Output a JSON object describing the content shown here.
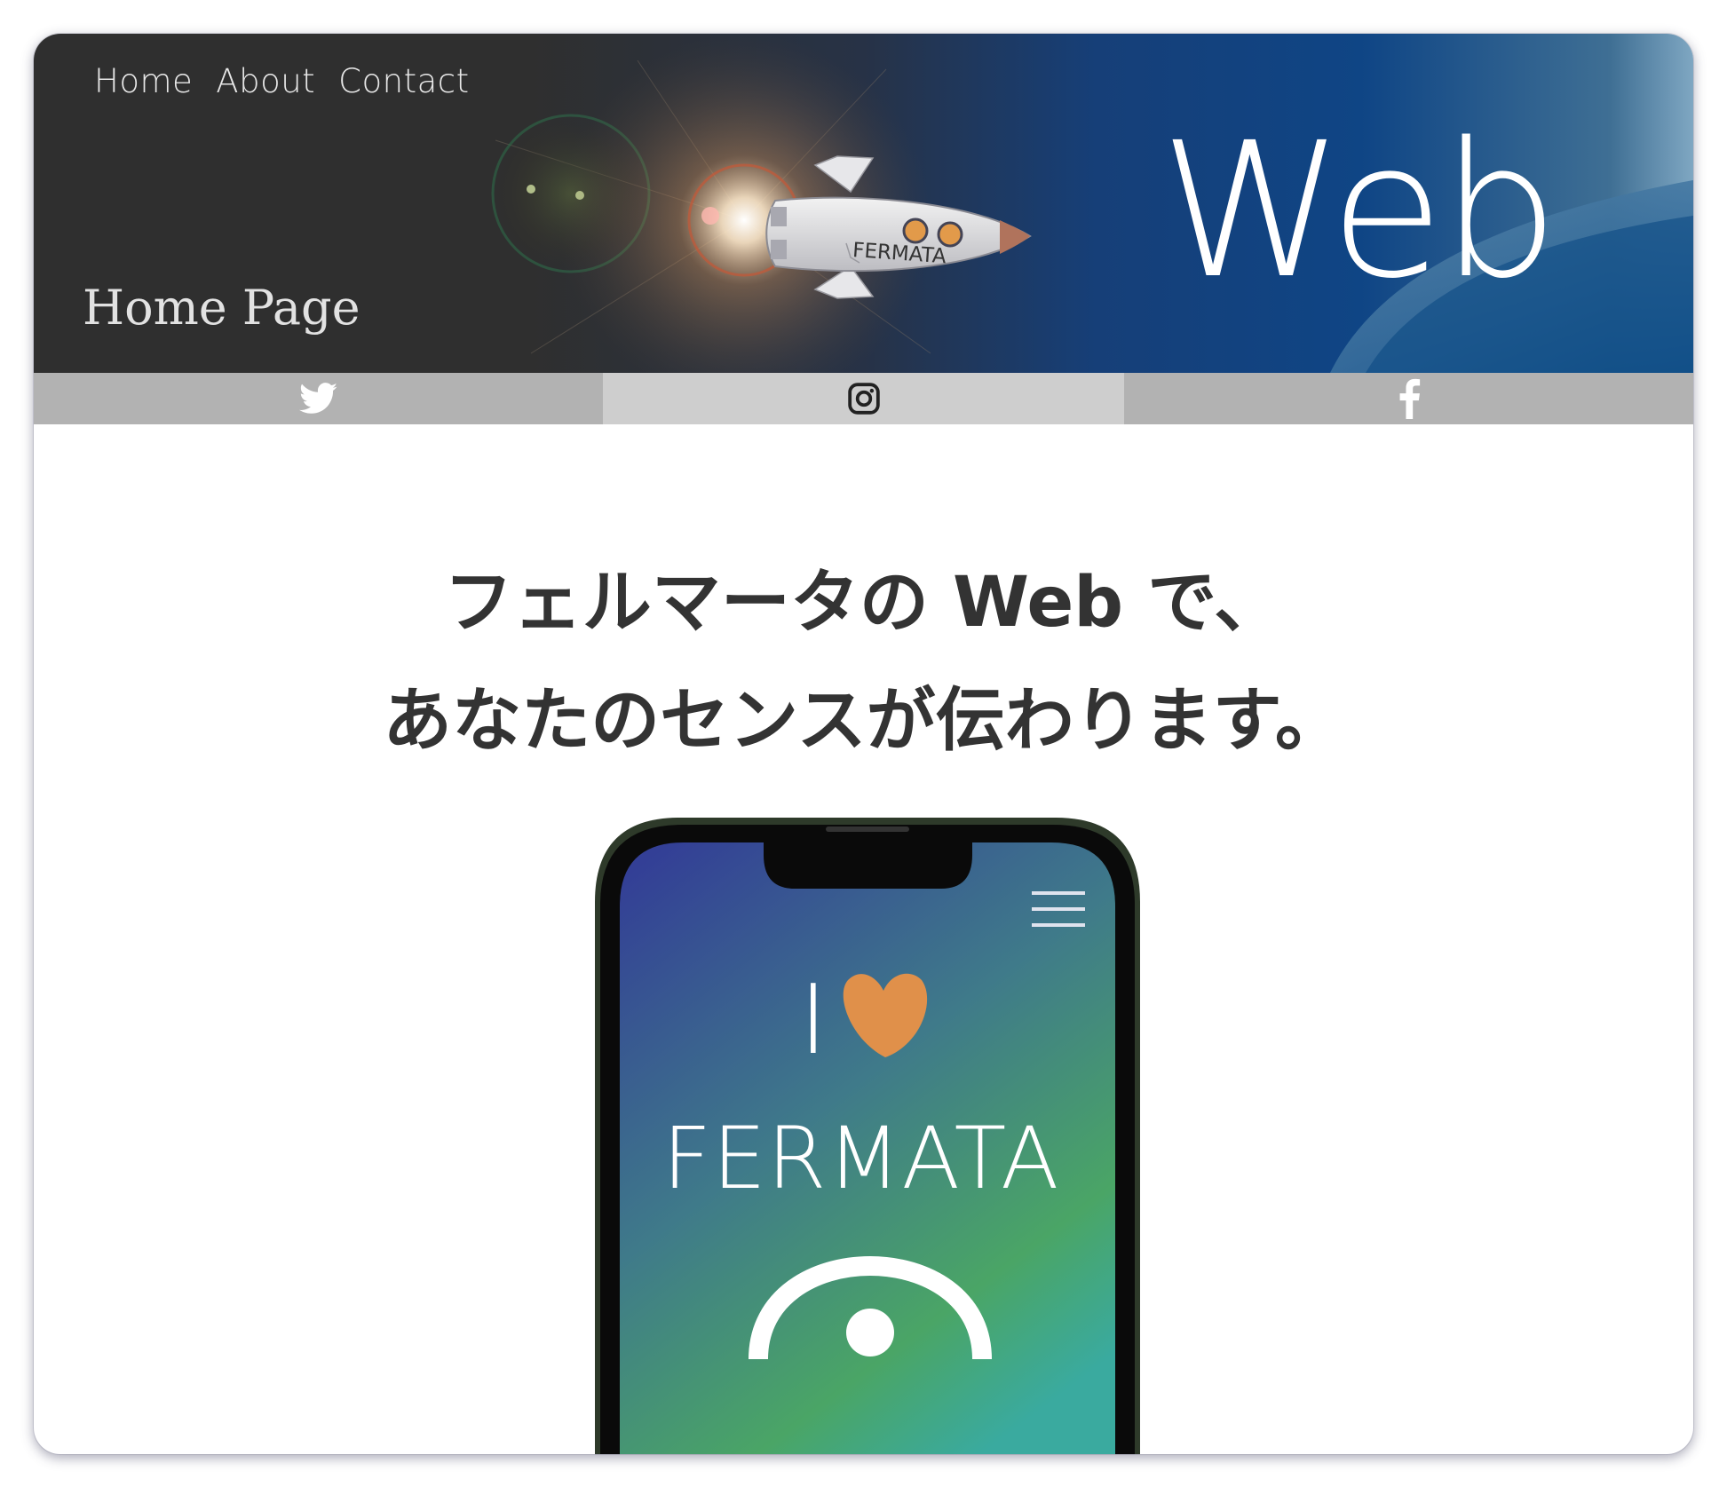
{
  "nav": {
    "items": [
      "Home",
      "About",
      "Contact"
    ]
  },
  "hero": {
    "title": "Home Page",
    "brand": "Web",
    "rocket_label": "FERMATA"
  },
  "social": {
    "icons": [
      "twitter-icon",
      "instagram-icon",
      "facebook-icon"
    ],
    "colors": {
      "side": "#b2b2b2",
      "middle": "#cecece"
    }
  },
  "main": {
    "headline_line1": "フェルマータの Web で、",
    "headline_line2": "あなたのセンスが伝わります。"
  },
  "phone": {
    "line1": "I",
    "line2": "FERMATA",
    "heart_color": "#e0904a",
    "screen_gradient": [
      "#333f96",
      "#3f7a8a",
      "#4aa566",
      "#3aaa9f"
    ]
  }
}
